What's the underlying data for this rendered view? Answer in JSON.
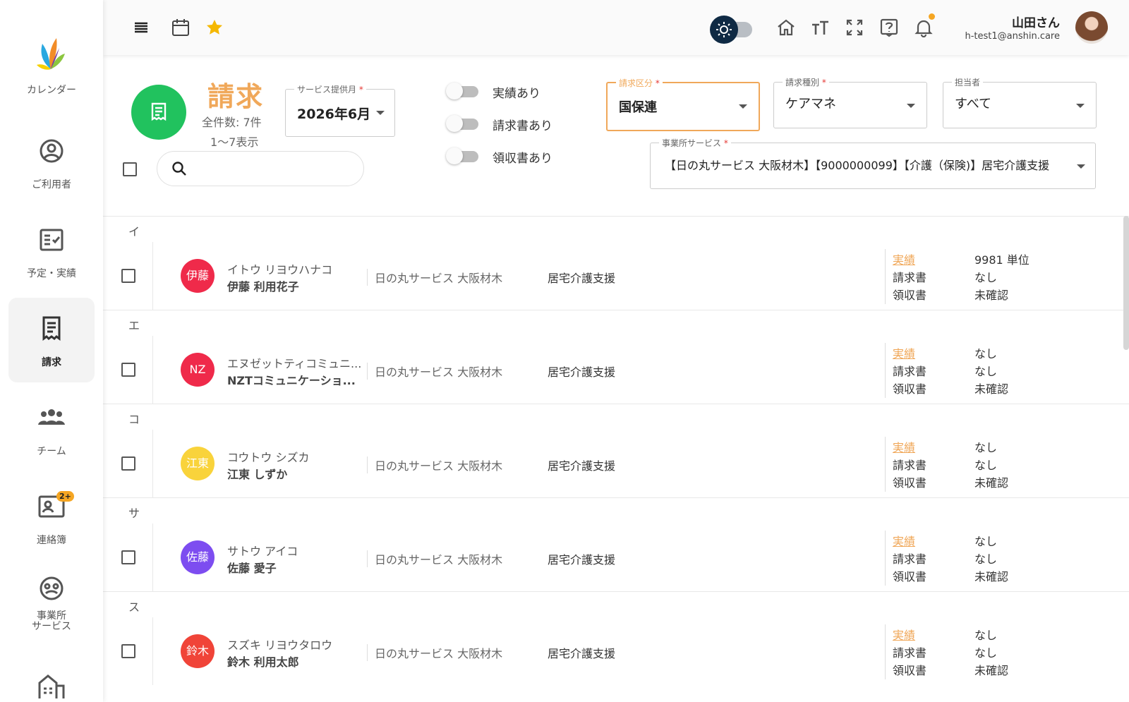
{
  "sidebar": {
    "items": [
      {
        "label": "カレンダー",
        "icon": "logo-icon"
      },
      {
        "label": "ご利用者",
        "icon": "user-circle-icon"
      },
      {
        "label": "予定・実績",
        "icon": "checklist-icon"
      },
      {
        "label": "請求",
        "icon": "receipt-icon",
        "active": true
      },
      {
        "label": "チーム",
        "icon": "team-icon"
      },
      {
        "label": "連絡簿",
        "icon": "contact-book-icon",
        "badge": "2+"
      },
      {
        "label": "事業所\nサービス",
        "icon": "office-service-icon"
      }
    ]
  },
  "topbar": {
    "user_name": "山田さん",
    "user_email": "h-test1@anshin.care"
  },
  "header": {
    "title": "請求",
    "count": "全件数: 7件",
    "range": "1〜7表示"
  },
  "filters": {
    "service_month": {
      "label": "サービス提供月",
      "required": "*",
      "value": "2026年6月"
    },
    "switches": [
      {
        "label": "実績あり"
      },
      {
        "label": "請求書あり"
      },
      {
        "label": "領収書あり"
      }
    ],
    "billing_category": {
      "label": "請求区分",
      "required": "*",
      "value": "国保連"
    },
    "billing_type": {
      "label": "請求種別",
      "required": "*",
      "value": "ケアマネ"
    },
    "assignee": {
      "label": "担当者",
      "value": "すべて"
    },
    "office_service": {
      "label": "事業所サービス",
      "required": "*",
      "value": "【日の丸サービス 大阪材木】【9000000099】【介護（保険)】居宅介護支援"
    }
  },
  "colors": {
    "accent_orange": "#f0a85a",
    "green": "#21c25e",
    "avatar_red": "#ef2a4a",
    "avatar_yellow": "#f9d33b",
    "avatar_purple": "#7d4df0",
    "avatar_redorange": "#f04438"
  },
  "groups": [
    {
      "letter": "イ",
      "rows": [
        {
          "avatar": "伊藤",
          "color": "#ef2a4a",
          "kana": "イトウ リヨウハナコ",
          "name": "伊藤 利用花子",
          "office": "日の丸サービス 大阪材木",
          "service": "居宅介護支援",
          "s1": "実績",
          "v1": "9981 単位",
          "s2": "請求書",
          "v2": "なし",
          "s3": "領収書",
          "v3": "未確認"
        }
      ]
    },
    {
      "letter": "エ",
      "rows": [
        {
          "avatar": "NZ",
          "color": "#ef2a4a",
          "kana": "エヌゼットティコミュニ...",
          "name": "NZTコミュニケーショ...",
          "office": "日の丸サービス 大阪材木",
          "service": "居宅介護支援",
          "s1": "実績",
          "v1": "なし",
          "s2": "請求書",
          "v2": "なし",
          "s3": "領収書",
          "v3": "未確認"
        }
      ]
    },
    {
      "letter": "コ",
      "rows": [
        {
          "avatar": "江東",
          "color": "#f9d33b",
          "kana": "コウトウ シズカ",
          "name": "江東 しずか",
          "office": "日の丸サービス 大阪材木",
          "service": "居宅介護支援",
          "s1": "実績",
          "v1": "なし",
          "s2": "請求書",
          "v2": "なし",
          "s3": "領収書",
          "v3": "未確認"
        }
      ]
    },
    {
      "letter": "サ",
      "rows": [
        {
          "avatar": "佐藤",
          "color": "#7d4df0",
          "kana": "サトウ アイコ",
          "name": "佐藤 愛子",
          "office": "日の丸サービス 大阪材木",
          "service": "居宅介護支援",
          "s1": "実績",
          "v1": "なし",
          "s2": "請求書",
          "v2": "なし",
          "s3": "領収書",
          "v3": "未確認"
        }
      ]
    },
    {
      "letter": "ス",
      "rows": [
        {
          "avatar": "鈴木",
          "color": "#f04438",
          "kana": "スズキ リヨウタロウ",
          "name": "鈴木 利用太郎",
          "office": "日の丸サービス 大阪材木",
          "service": "居宅介護支援",
          "s1": "実績",
          "v1": "なし",
          "s2": "請求書",
          "v2": "なし",
          "s3": "領収書",
          "v3": "未確認"
        }
      ]
    }
  ]
}
